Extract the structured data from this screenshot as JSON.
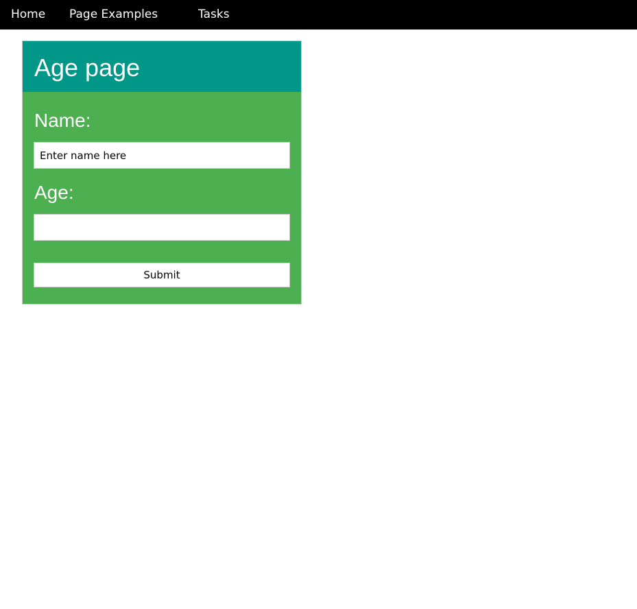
{
  "nav": {
    "items": [
      {
        "label": "Home"
      },
      {
        "label": "Page Examples"
      },
      {
        "label": "Tasks"
      }
    ]
  },
  "form": {
    "title": "Age page",
    "name_label": "Name:",
    "name_placeholder": "Enter name here",
    "name_value": "",
    "age_label": "Age:",
    "age_placeholder": "",
    "age_value": "",
    "submit_label": "Submit"
  },
  "colors": {
    "navbar": "#000000",
    "header": "#009688",
    "card": "#4caf50",
    "text_on_color": "#ffffff"
  }
}
